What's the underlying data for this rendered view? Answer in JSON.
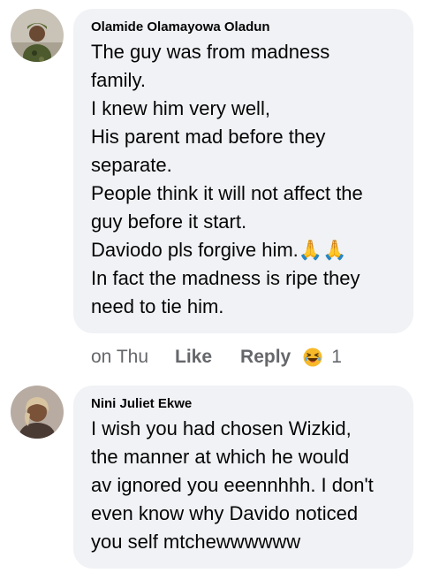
{
  "comments": [
    {
      "author": "Olamide Olamayowa Oladun",
      "lines": [
        "The guy was from madness",
        "family.",
        "I knew him very well,",
        "His parent mad before they",
        "separate.",
        "People think it will not affect the",
        "guy before it start.",
        "Daviodo pls forgive him.🙏🙏",
        "In fact the madness is ripe they",
        "need to tie him."
      ],
      "time": "on Thu",
      "like_label": "Like",
      "reply_label": "Reply",
      "reaction_icon": "laughing-emoji-icon",
      "reaction_count": "1"
    },
    {
      "author": "Nini Juliet Ekwe",
      "lines": [
        "I wish you had chosen Wizkid,",
        "the manner at which he would",
        "av ignored you eeennhhh. I don't",
        "even know why Davido noticed",
        "you self mtchewwwwww"
      ]
    }
  ],
  "colors": {
    "bubble": "#f0f2f5",
    "text": "#050505",
    "secondary": "#65676b"
  }
}
